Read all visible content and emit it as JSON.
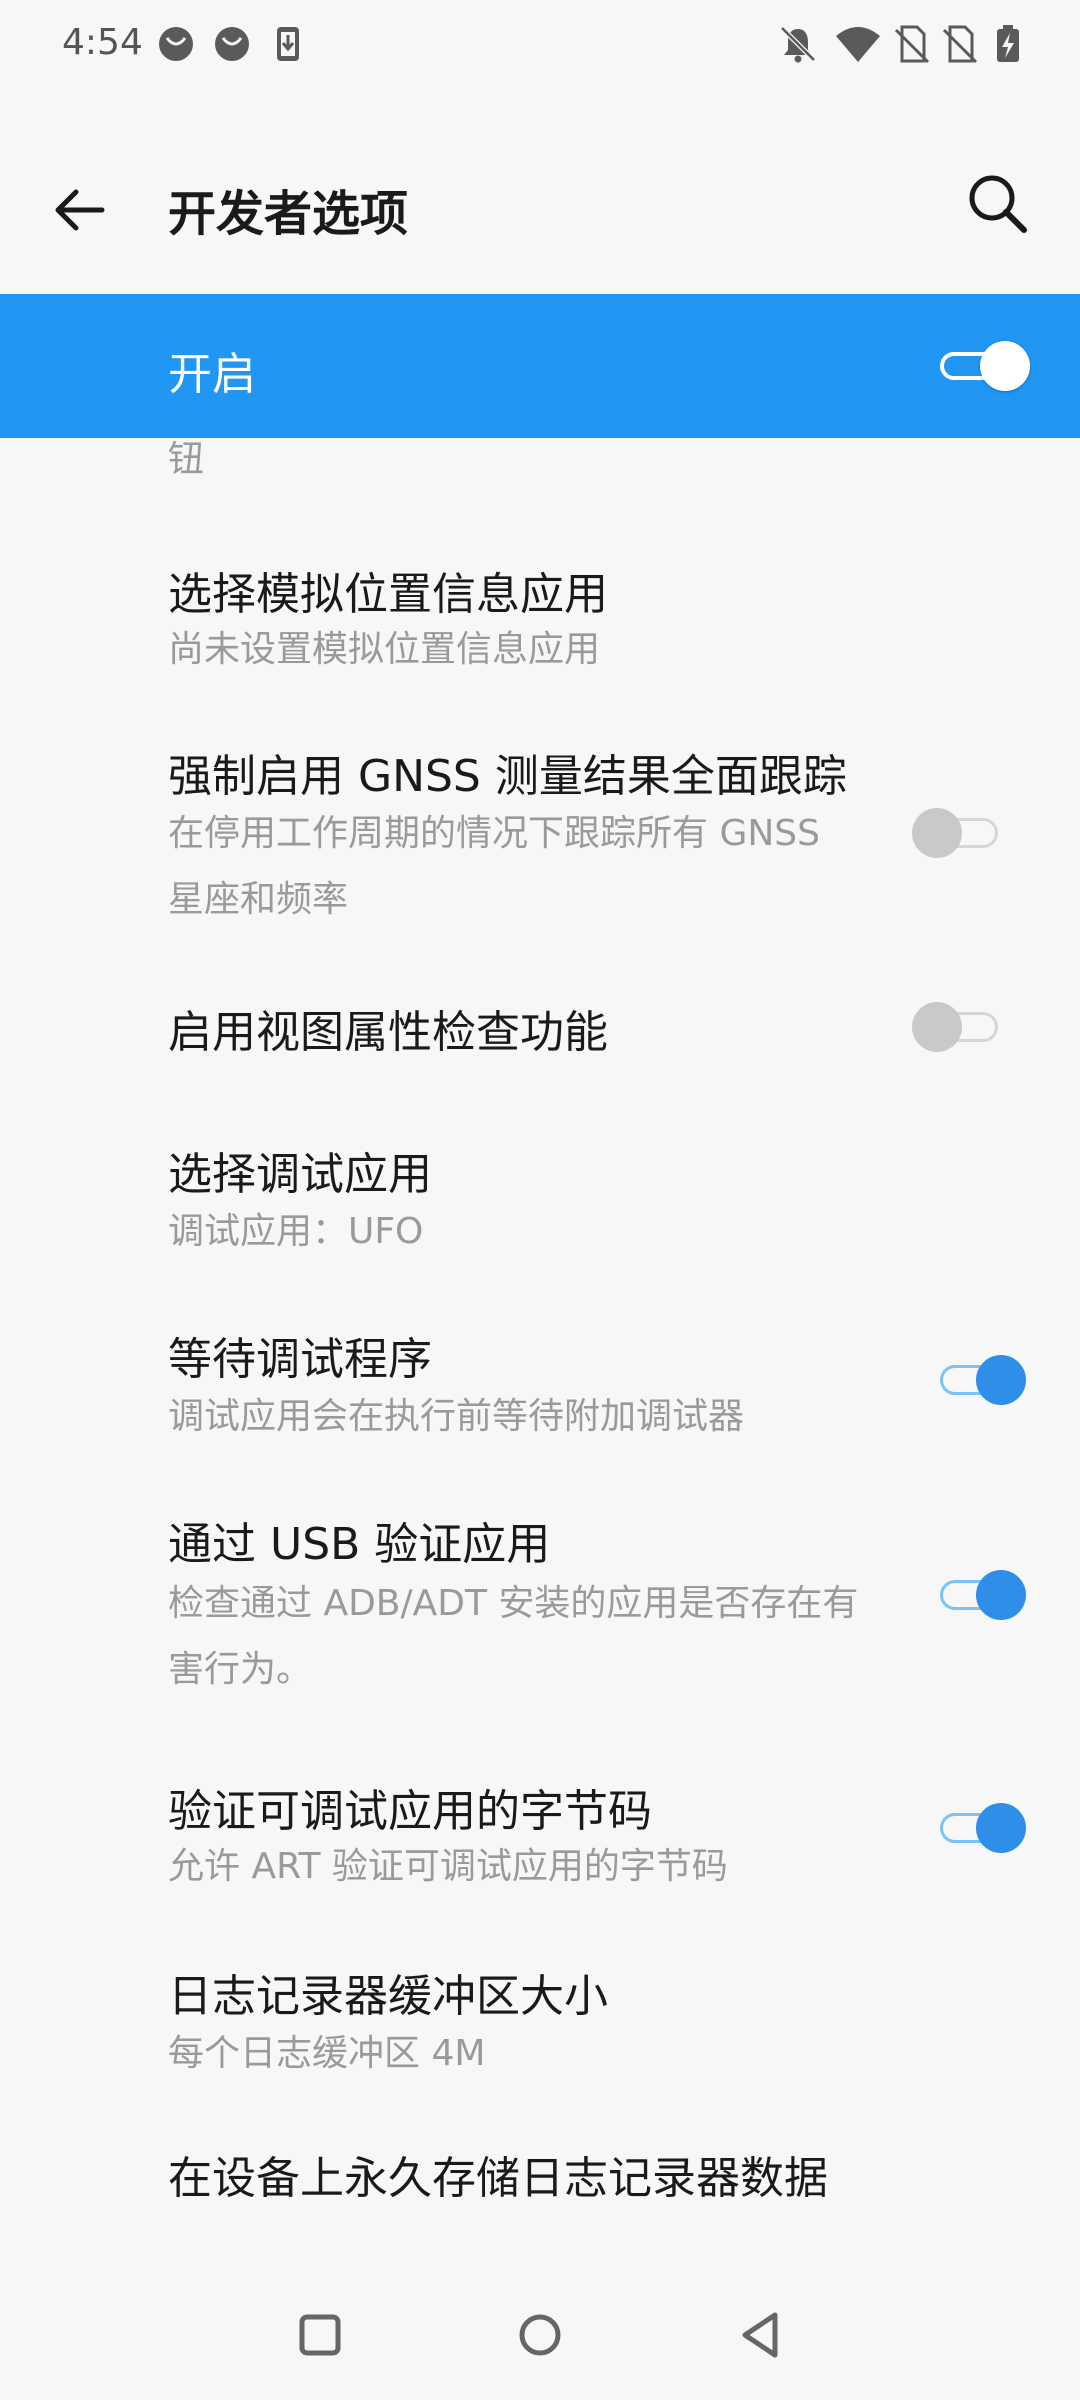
{
  "status_bar": {
    "time": "4:54",
    "icons": [
      "app-notification-icon",
      "app-notification-icon",
      "download-icon",
      "bell-muted-icon",
      "wifi-icon",
      "no-sim-icon",
      "no-sim-icon",
      "battery-charging-icon"
    ]
  },
  "app_bar": {
    "title": "开发者选项",
    "back_icon": "arrow-left-icon",
    "search_icon": "search-icon"
  },
  "master": {
    "label": "开启",
    "enabled": true
  },
  "list": {
    "clipped_text": "钮",
    "items": [
      {
        "title": "选择模拟位置信息应用",
        "subtitle": "尚未设置模拟位置信息应用"
      },
      {
        "title": "强制启用 GNSS 测量结果全面跟踪",
        "subtitle_line1": "在停用工作周期的情况下跟踪所有 GNSS",
        "subtitle_line2": "星座和频率",
        "toggle": false
      },
      {
        "title": "启用视图属性检查功能",
        "toggle": false
      },
      {
        "title": "选择调试应用",
        "subtitle": "调试应用：UFO"
      },
      {
        "title": "等待调试程序",
        "subtitle": "调试应用会在执行前等待附加调试器",
        "toggle": true
      },
      {
        "title": "通过 USB 验证应用",
        "subtitle_line1": "检查通过 ADB/ADT 安装的应用是否存在有",
        "subtitle_line2": "害行为。",
        "toggle": true
      },
      {
        "title": "验证可调试应用的字节码",
        "subtitle": "允许 ART 验证可调试应用的字节码",
        "toggle": true
      },
      {
        "title": "日志记录器缓冲区大小",
        "subtitle": "每个日志缓冲区 4M"
      },
      {
        "title": "在设备上永久存储日志记录器数据"
      }
    ]
  },
  "nav_bar": {
    "icons": [
      "recents-square-icon",
      "home-circle-icon",
      "back-triangle-icon"
    ]
  },
  "colors": {
    "accent": "#2196f3",
    "background": "#f7f7f7",
    "toggle_on": "#2f8fe8",
    "toggle_off": "#c9c9c9"
  }
}
